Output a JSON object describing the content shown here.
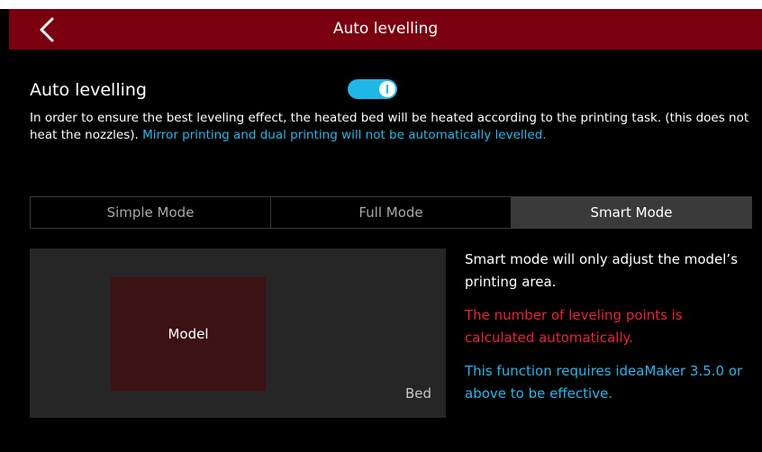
{
  "header": {
    "title": "Auto levelling",
    "back_icon": "chevron-left-icon"
  },
  "auto_levelling": {
    "label": "Auto levelling",
    "toggle_on": true,
    "description_main": "In order to ensure the best leveling effect, the heated bed will be heated according to the printing task. (this does not heat the nozzles). ",
    "description_highlight": "Mirror printing and dual printing will not be automatically levelled."
  },
  "tabs": [
    {
      "label": "Simple Mode",
      "active": false
    },
    {
      "label": "Full Mode",
      "active": false
    },
    {
      "label": "Smart Mode",
      "active": true
    }
  ],
  "preview": {
    "model_label": "Model",
    "bed_label": "Bed"
  },
  "info": {
    "line1": "Smart mode will only adjust the model’s printing area.",
    "line2": "The number of leveling points is calculated automatically.",
    "line3": "This function requires ideaMaker 3.5.0 or above to be effective."
  },
  "colors": {
    "header_bg": "#7a0010",
    "accent_blue": "#2bb6e8",
    "warning_red": "#e8243c",
    "toggle_on": "#1fb8e6"
  }
}
